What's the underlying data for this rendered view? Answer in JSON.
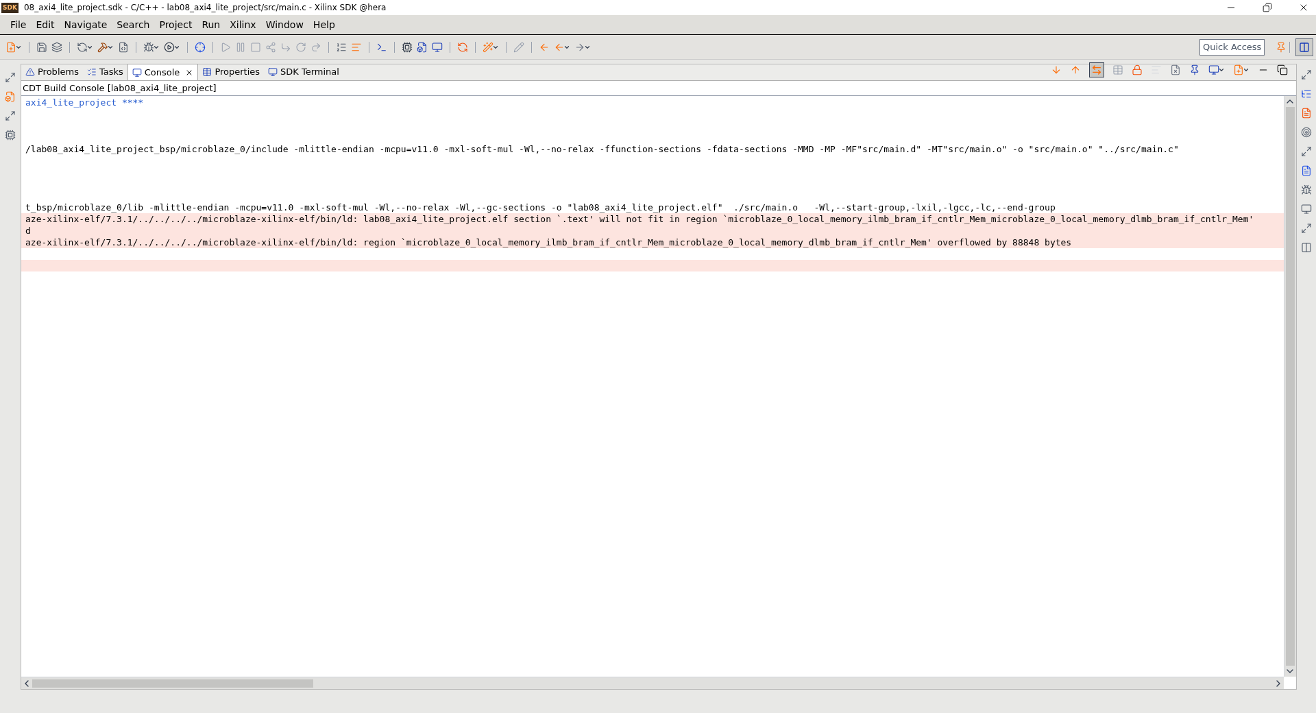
{
  "window": {
    "app_icon_label": "SDK",
    "title": "08_axi4_lite_project.sdk - C/C++ - lab08_axi4_lite_project/src/main.c - Xilinx SDK @hera"
  },
  "menu": [
    "File",
    "Edit",
    "Navigate",
    "Search",
    "Project",
    "Run",
    "Xilinx",
    "Window",
    "Help"
  ],
  "quick_access": {
    "placeholder": "Quick Access"
  },
  "tabs": [
    {
      "label": "Problems",
      "selected": false
    },
    {
      "label": "Tasks",
      "selected": false
    },
    {
      "label": "Console",
      "selected": true
    },
    {
      "label": "Properties",
      "selected": false
    },
    {
      "label": "SDK Terminal",
      "selected": false
    }
  ],
  "console": {
    "title": "CDT Build Console [lab08_axi4_lite_project]",
    "lines": [
      {
        "kind": "info",
        "text": "axi4_lite_project ****"
      },
      {
        "kind": "blank"
      },
      {
        "kind": "blank"
      },
      {
        "kind": "blank"
      },
      {
        "kind": "normal",
        "text": "/lab08_axi4_lite_project_bsp/microblaze_0/include -mlittle-endian -mcpu=v11.0 -mxl-soft-mul -Wl,--no-relax -ffunction-sections -fdata-sections -MMD -MP -MF\"src/main.d\" -MT\"src/main.o\" -o \"src/main.o\" \"../src/main.c\""
      },
      {
        "kind": "blank"
      },
      {
        "kind": "blank"
      },
      {
        "kind": "blank"
      },
      {
        "kind": "blank"
      },
      {
        "kind": "normal",
        "text": "t_bsp/microblaze_0/lib -mlittle-endian -mcpu=v11.0 -mxl-soft-mul -Wl,--no-relax -Wl,--gc-sections -o \"lab08_axi4_lite_project.elf\"  ./src/main.o   -Wl,--start-group,-lxil,-lgcc,-lc,--end-group"
      },
      {
        "kind": "error",
        "text": "aze-xilinx-elf/7.3.1/../../../../microblaze-xilinx-elf/bin/ld: lab08_axi4_lite_project.elf section `.text' will not fit in region `microblaze_0_local_memory_ilmb_bram_if_cntlr_Mem_microblaze_0_local_memory_dlmb_bram_if_cntlr_Mem'"
      },
      {
        "kind": "error",
        "text": "d"
      },
      {
        "kind": "error",
        "text": "aze-xilinx-elf/7.3.1/../../../../microblaze-xilinx-elf/bin/ld: region `microblaze_0_local_memory_ilmb_bram_if_cntlr_Mem_microblaze_0_local_memory_dlmb_bram_if_cntlr_Mem' overflowed by 88848 bytes"
      },
      {
        "kind": "blank"
      },
      {
        "kind": "error"
      }
    ]
  }
}
